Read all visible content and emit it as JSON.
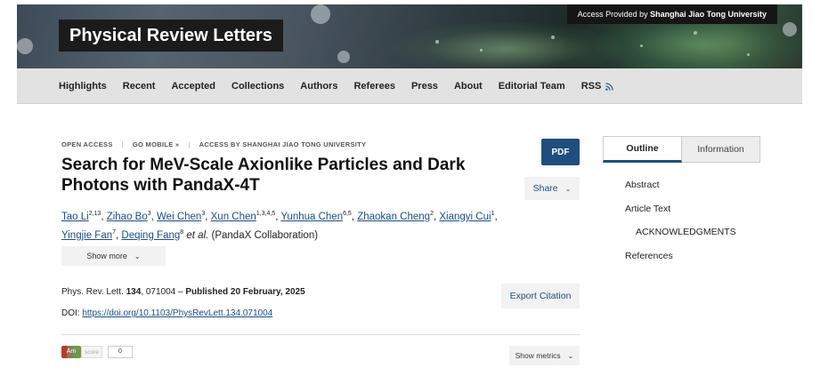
{
  "header": {
    "journal_title": "Physical Review Letters",
    "access_prefix": "Access Provided by",
    "access_institution": "Shanghai Jiao Tong University"
  },
  "nav": {
    "items": [
      "Highlights",
      "Recent",
      "Accepted",
      "Collections",
      "Authors",
      "Referees",
      "Press",
      "About",
      "Editorial Team",
      "RSS"
    ]
  },
  "meta": {
    "open_access": "OPEN ACCESS",
    "go_mobile": "GO MOBILE »",
    "access_by": "ACCESS BY SHANGHAI JIAO TONG UNIVERSITY"
  },
  "article": {
    "title": "Search for MeV-Scale Axionlike Particles and Dark Photons with PandaX-4T",
    "authors": [
      {
        "name": "Tao Li",
        "aff": "2,13"
      },
      {
        "name": "Zihao Bo",
        "aff": "3"
      },
      {
        "name": "Wei Chen",
        "aff": "3"
      },
      {
        "name": "Xun Chen",
        "aff": "1,3,4,5"
      },
      {
        "name": "Yunhua Chen",
        "aff": "6,5"
      },
      {
        "name": "Zhaokan Cheng",
        "aff": "2"
      },
      {
        "name": "Xiangyi Cui",
        "aff": "1"
      },
      {
        "name": "Yingjie Fan",
        "aff": "7"
      },
      {
        "name": "Deqing Fang",
        "aff": "8"
      }
    ],
    "et_al": "et al.",
    "collaboration": "(PandaX Collaboration)",
    "show_more": "Show more",
    "journal_abbrev": "Phys. Rev. Lett.",
    "volume": "134",
    "article_number": ", 071004 –",
    "published": "Published 20 February, 2025",
    "doi_label": "DOI:",
    "doi_url": "https://doi.org/10.1103/PhysRevLett.134.071004"
  },
  "altmetric": {
    "badge": "Am",
    "label": "score",
    "score": "0"
  },
  "buttons": {
    "pdf": "PDF",
    "share": "Share",
    "export_citation": "Export Citation",
    "show_metrics": "Show metrics"
  },
  "sidebar": {
    "tabs": [
      "Outline",
      "Information"
    ],
    "outline": [
      "Abstract",
      "Article Text",
      "ACKNOWLEDGMENTS",
      "References"
    ]
  },
  "colors": {
    "accent": "#1e4e7e",
    "link": "#1a4e8a",
    "nav_bg": "#e2e2e2"
  }
}
